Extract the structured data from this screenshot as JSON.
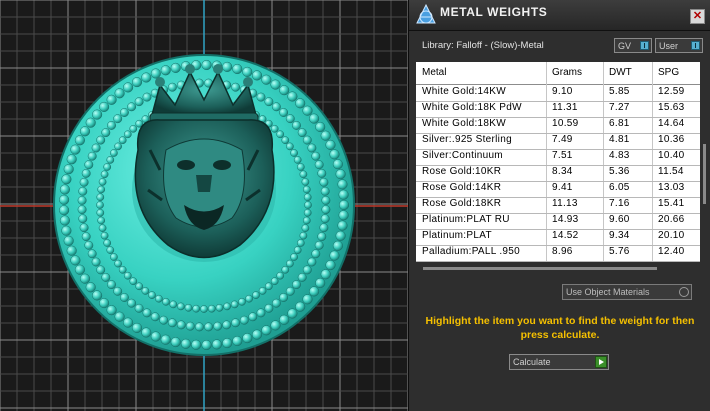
{
  "panel": {
    "title": "METAL WEIGHTS",
    "close_glyph": "✕",
    "library_label": "Library: Falloff - (Slow)-Metal",
    "gv_label": "GV",
    "user_label": "User",
    "materials_label": "Use Object Materials",
    "hint_text": "Highlight the item you want to find the weight for then press calculate.",
    "calculate_label": "Calculate"
  },
  "table": {
    "columns": [
      "Metal",
      "Grams",
      "DWT",
      "SPG"
    ],
    "rows": [
      [
        "White Gold:14KW",
        "9.10",
        "5.85",
        "12.59"
      ],
      [
        "White Gold:18K PdW",
        "11.31",
        "7.27",
        "15.63"
      ],
      [
        "White Gold:18KW",
        "10.59",
        "6.81",
        "14.64"
      ],
      [
        "Silver:.925 Sterling",
        "7.49",
        "4.81",
        "10.36"
      ],
      [
        "Silver:Continuum",
        "7.51",
        "4.83",
        "10.40"
      ],
      [
        "Rose Gold:10KR",
        "8.34",
        "5.36",
        "11.54"
      ],
      [
        "Rose Gold:14KR",
        "9.41",
        "6.05",
        "13.03"
      ],
      [
        "Rose Gold:18KR",
        "11.13",
        "7.16",
        "15.41"
      ],
      [
        "Platinum:PLAT RU",
        "14.93",
        "9.60",
        "20.66"
      ],
      [
        "Platinum:PLAT",
        "14.52",
        "9.34",
        "20.10"
      ],
      [
        "Palladium:PALL .950",
        "8.96",
        "5.76",
        "12.40"
      ]
    ]
  },
  "icons": {
    "app": "metal-weights-app-icon",
    "close": "close-icon",
    "gv_toggle": "toggle-icon",
    "materials": "dropdown-icon",
    "calculate": "play-arrow-icon"
  },
  "colors": {
    "model": "#3fd6c6",
    "hint": "#f5c000",
    "grid": "#6a6a6a",
    "axis_v": "#2fa3c4",
    "axis_h": "#c0392b"
  }
}
